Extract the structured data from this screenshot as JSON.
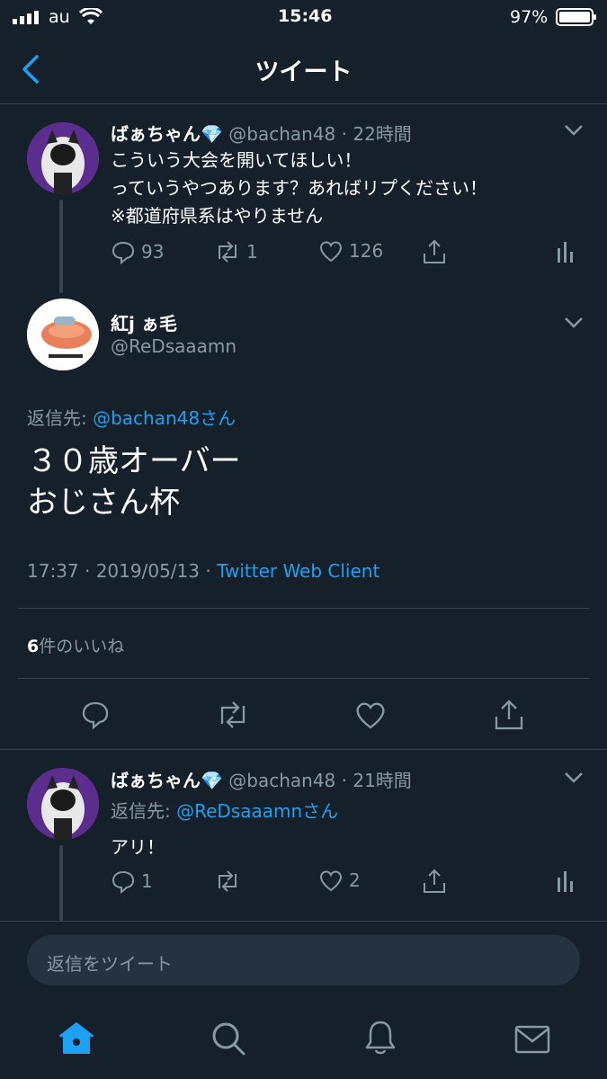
{
  "status_bar": {
    "carrier": "au",
    "time": "15:46",
    "battery": "97%"
  },
  "nav": {
    "title": "ツイート"
  },
  "tweet1": {
    "display_name": "ばぁちゃん💎",
    "handle": "@bachan48",
    "time_ago": "· 22時間",
    "lines": [
      "こういう大会を開いてほしい！",
      "っていうやつあります？あればリプください！",
      "※都道府県系はやりません"
    ],
    "replies": "93",
    "retweets": "1",
    "likes": "126"
  },
  "main_tweet": {
    "display_name": "紅j ぁ毛",
    "handle": "@ReDsaaamn",
    "reply_to_label": "返信先:",
    "reply_to_handle": "@bachan48さん",
    "text_line1": "３０歳オーバー",
    "text_line2": "おじさん杯",
    "timestamp": "17:37 · 2019/05/13 ·",
    "client": "Twitter Web Client",
    "likes_count": "6",
    "likes_label": "件のいいね"
  },
  "tweet3": {
    "display_name": "ばぁちゃん💎",
    "handle": "@bachan48",
    "time_ago": "· 21時間",
    "reply_to_label": "返信先:",
    "reply_to_handle": "@ReDsaaamnさん",
    "text": "アリ！",
    "replies": "1",
    "retweets": "",
    "likes": "2"
  },
  "reply_input": {
    "placeholder": "返信をツイート"
  },
  "colors": {
    "background": "#15202b",
    "accent": "#1da1f2",
    "muted": "#8899a6",
    "divider": "#38444d"
  }
}
